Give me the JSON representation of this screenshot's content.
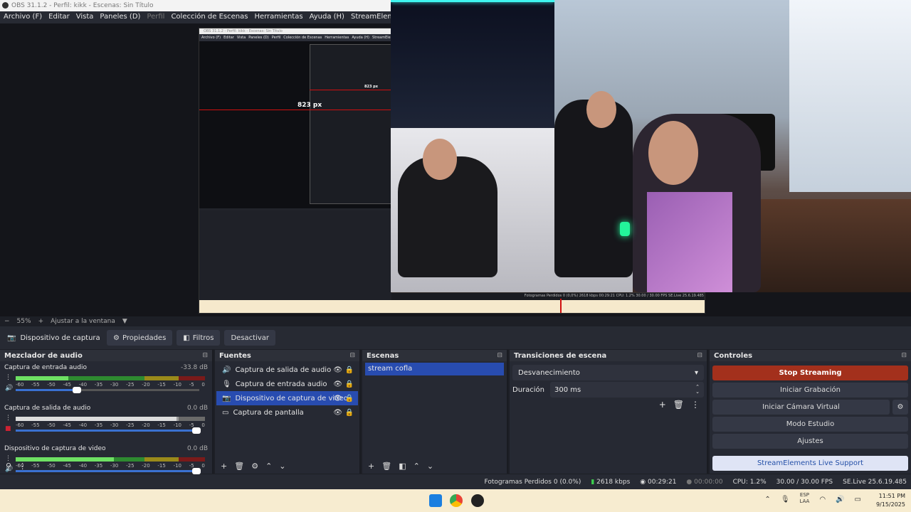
{
  "window": {
    "title": "OBS 31.1.2 - Perfil: kikk - Escenas: Sin Título"
  },
  "menu": {
    "items": [
      "Archivo (F)",
      "Editar",
      "Vista",
      "Paneles (D)",
      "Perfil",
      "Colección de Escenas",
      "Herramientas",
      "Ayuda (H)",
      "StreamElements"
    ]
  },
  "preview": {
    "measure_label": "823 px",
    "zoom": "55%",
    "fit_label": "Ajustar a la ventana"
  },
  "nested": {
    "title": "OBS 31.1.2 - Perfil: kikk - Escenas: Sin Título",
    "menu": [
      "Archivo (F)",
      "Editar",
      "Vista",
      "Paneles (D)",
      "Perfil",
      "Colección de Escenas",
      "Herramientas",
      "Ayuda (H)",
      "StreamElements"
    ],
    "inner_label": "823 px",
    "status": "Fotogramas Perdidos 0 (0,0%)   2618 kbps   00:29:21   CPU: 1.2%   30.00 / 30.00 FPS   SE.Live 25.6.19.485"
  },
  "toolbar": {
    "source_label": "Dispositivo de captura de v",
    "properties": "Propiedades",
    "filters": "Filtros",
    "deactivate": "Desactivar"
  },
  "mixer": {
    "title": "Mezclador de audio",
    "scale": [
      "-60",
      "-55",
      "-50",
      "-45",
      "-40",
      "-35",
      "-30",
      "-25",
      "-20",
      "-15",
      "-10",
      "-5",
      "0"
    ],
    "channels": [
      {
        "name": "Captura de entrada audio",
        "db": "-33.8 dB",
        "level": 0.28,
        "volume": 0.35,
        "muted": false
      },
      {
        "name": "Captura de salida de audio",
        "db": "0.0 dB",
        "level": 0.85,
        "volume": 1.0,
        "muted": true
      },
      {
        "name": "Dispositivo de captura de video",
        "db": "0.0 dB",
        "level": 0.52,
        "volume": 1.0,
        "muted": false
      }
    ]
  },
  "sources": {
    "title": "Fuentes",
    "items": [
      {
        "label": "Captura de salida de audio",
        "icon": "speaker-icon",
        "selected": false
      },
      {
        "label": "Captura de entrada audio",
        "icon": "microphone-icon",
        "selected": false
      },
      {
        "label": "Dispositivo de captura de video",
        "icon": "camera-icon",
        "selected": true
      },
      {
        "label": "Captura de pantalla",
        "icon": "monitor-icon",
        "selected": false
      }
    ]
  },
  "scenes": {
    "title": "Escenas",
    "items": [
      "stream cofla"
    ]
  },
  "transitions": {
    "title": "Transiciones de escena",
    "selected": "Desvanecimiento",
    "duration_label": "Duración",
    "duration_value": "300 ms"
  },
  "controls": {
    "title": "Controles",
    "stop_streaming": "Stop Streaming",
    "start_recording": "Iniciar Grabación",
    "virtual_camera": "Iniciar Cámara Virtual",
    "studio_mode": "Modo Estudio",
    "settings": "Ajustes",
    "se_support": "StreamElements Live Support"
  },
  "status": {
    "dropped": "Fotogramas Perdidos 0 (0.0%)",
    "bitrate": "2618 kbps",
    "stream_time": "00:29:21",
    "rec_time": "00:00:00",
    "cpu": "CPU: 1.2%",
    "fps": "30.00 / 30.00 FPS",
    "se": "SE.Live 25.6.19.485"
  },
  "taskbar": {
    "lang": "ESP",
    "lang2": "LAA",
    "time": "11:51 PM",
    "date": "9/15/2025"
  },
  "colors": {
    "accent": "#284cb0",
    "stop": "#a3301c",
    "meter_green": "#6ee063"
  }
}
